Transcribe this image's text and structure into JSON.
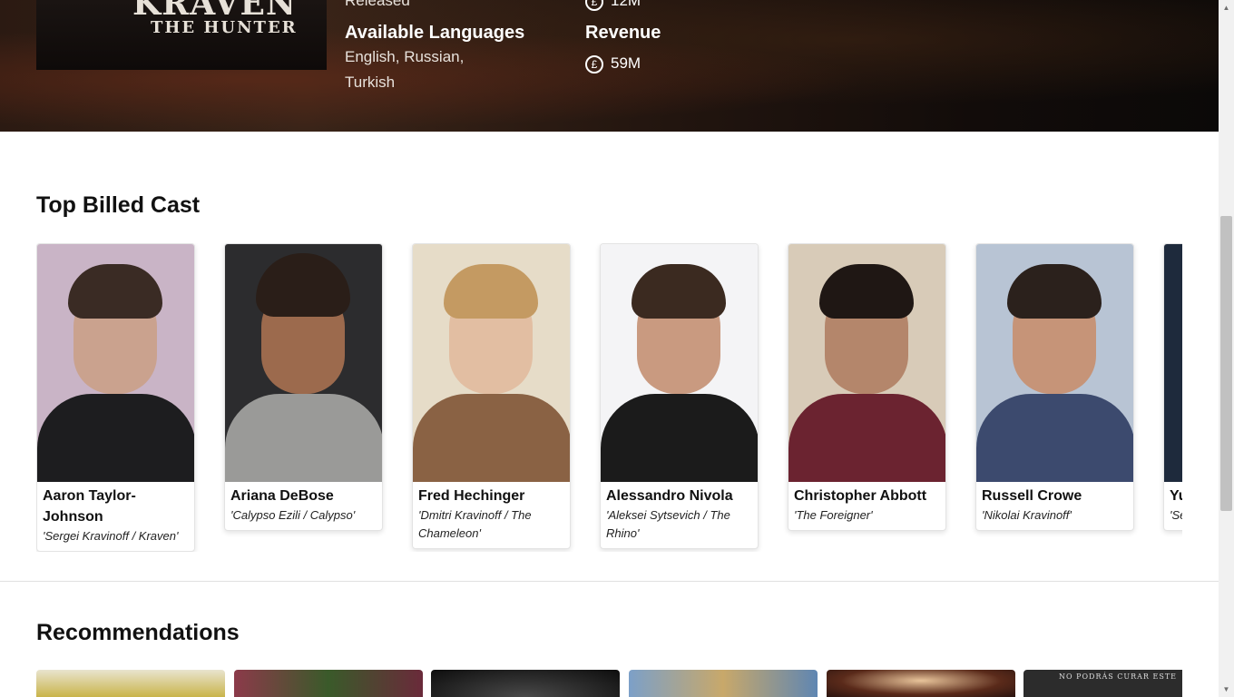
{
  "hero": {
    "poster_title": "KRAVEN",
    "poster_subtitle": "THE HUNTER",
    "status_value": "Released",
    "budget_value": "12M",
    "languages_heading": "Available Languages",
    "languages_line1": "English, Russian,",
    "languages_line2": "Turkish",
    "revenue_heading": "Revenue",
    "revenue_value": "59M",
    "currency_symbol": "£"
  },
  "cast": {
    "title": "Top Billed Cast",
    "members": [
      {
        "name": "Aaron Taylor-Johnson",
        "role": "'Sergei Kravinoff / Kraven'"
      },
      {
        "name": "Ariana DeBose",
        "role": "'Calypso Ezili / Calypso'"
      },
      {
        "name": "Fred Hechinger",
        "role": "'Dmitri Kravinoff / The Chameleon'"
      },
      {
        "name": "Alessandro Nivola",
        "role": "'Aleksei Sytsevich / The Rhino'"
      },
      {
        "name": "Christopher Abbott",
        "role": "'The Foreigner'"
      },
      {
        "name": "Russell Crowe",
        "role": "'Nikolai Kravinoff'"
      },
      {
        "name": "Yu",
        "role": "'Se"
      }
    ]
  },
  "recommendations": {
    "title": "Recommendations",
    "partial_poster_text": "NO PODRÁS CURAR ESTE"
  },
  "colors": {
    "background": "#ffffff",
    "hero_dark": "#1a110c",
    "text_dark": "#111111",
    "scroll_thumb": "#c1c1c1"
  }
}
